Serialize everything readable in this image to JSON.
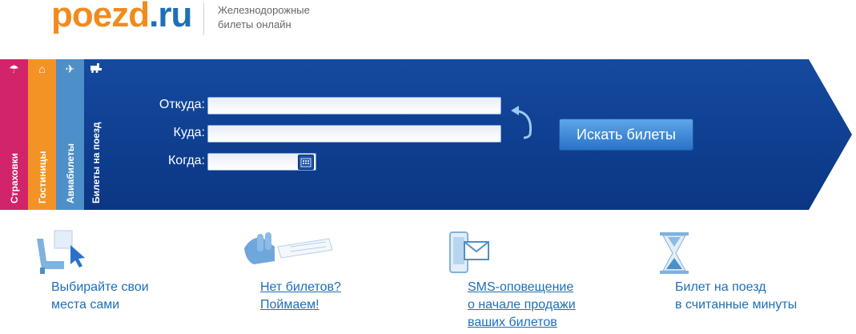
{
  "header": {
    "logo_part1": "poezd",
    "logo_part2": ".ru",
    "tagline_line1": "Железнодорожные",
    "tagline_line2": "билеты онлайн"
  },
  "tabs": [
    {
      "label": "Страховки",
      "icon": "umbrella-icon"
    },
    {
      "label": "Гостиницы",
      "icon": "hotel-icon"
    },
    {
      "label": "Авиабилеты",
      "icon": "plane-icon"
    },
    {
      "label": "Билеты на поезд",
      "icon": "train-icon"
    }
  ],
  "form": {
    "from_label": "Откуда:",
    "to_label": "Куда:",
    "when_label": "Когда:",
    "from_value": "",
    "to_value": "",
    "when_value": "",
    "search_label": "Искать билеты"
  },
  "features": [
    {
      "line1": "Выбирайте свои",
      "line2": "места сами",
      "line3": "",
      "link": false,
      "icon": "seat-select-icon"
    },
    {
      "line1": "Нет билетов?",
      "line2": "Поймаем!",
      "line3": "",
      "link": true,
      "icon": "hand-ticket-icon"
    },
    {
      "line1": "SMS-оповещение",
      "line2": "о начале продажи",
      "line3": "ваших билетов",
      "link": true,
      "icon": "phone-message-icon"
    },
    {
      "line1": "Билет на поезд",
      "line2": "в считанные минуты",
      "line3": "",
      "link": false,
      "icon": "hourglass-icon"
    }
  ],
  "colors": {
    "banner": "#0d3c8c",
    "logo_orange": "#f28b1d",
    "logo_blue": "#1d6fb8",
    "tab_insurance": "#d1246a",
    "tab_hotels": "#f39326",
    "tab_air": "#4d8fc9"
  }
}
